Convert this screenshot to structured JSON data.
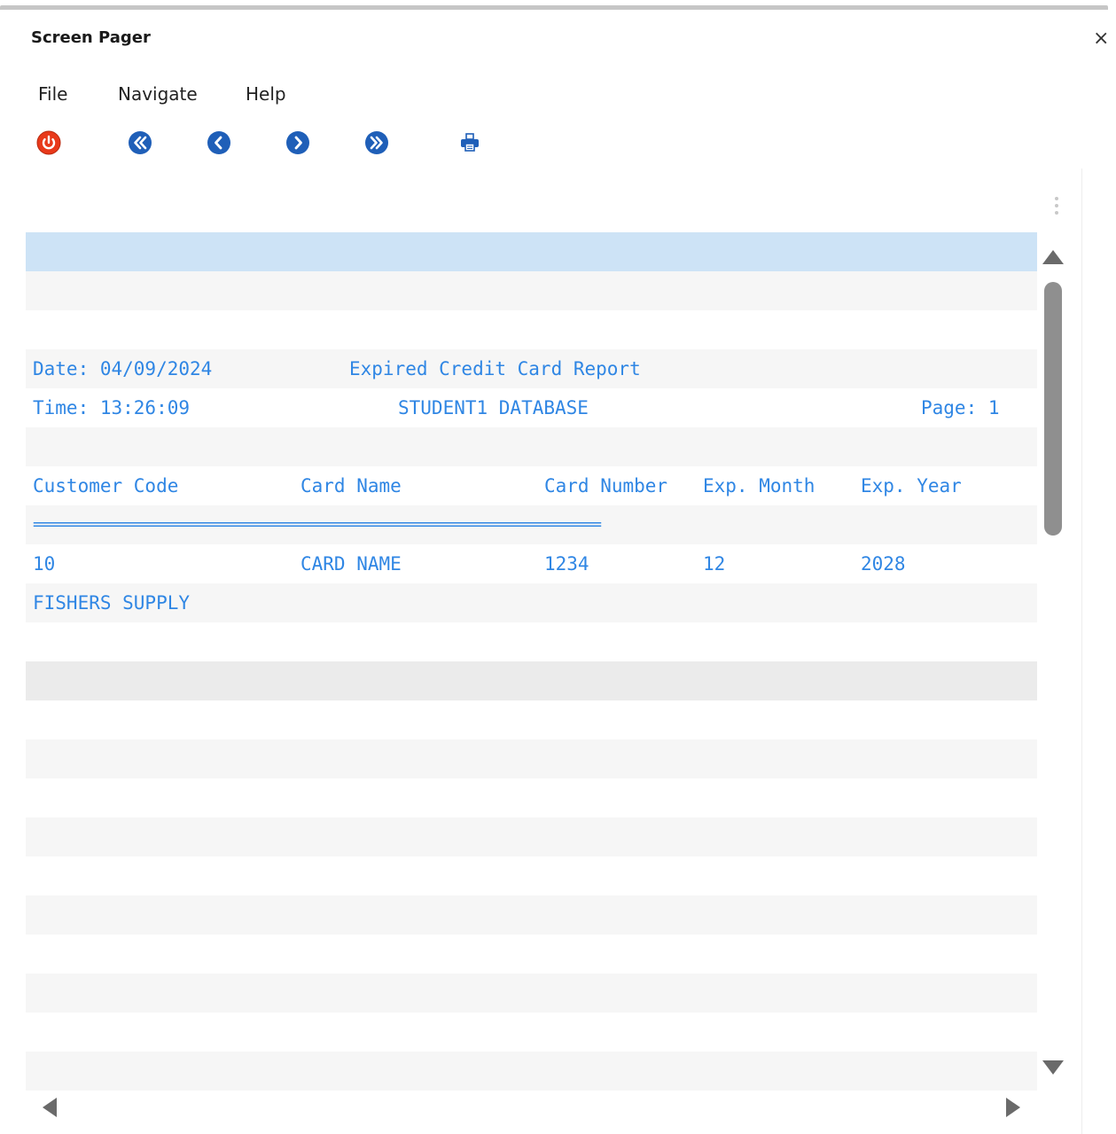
{
  "window": {
    "title": "Screen Pager",
    "close_glyph": "×"
  },
  "menu": {
    "items": [
      {
        "label": "File"
      },
      {
        "label": "Navigate"
      },
      {
        "label": "Help"
      }
    ]
  },
  "toolbar": {
    "buttons": [
      {
        "icon": "power-icon",
        "color": "#e8391a"
      },
      {
        "icon": "first-page-icon",
        "color": "#1f5fb8"
      },
      {
        "icon": "previous-page-icon",
        "color": "#1f5fb8"
      },
      {
        "icon": "next-page-icon",
        "color": "#1f5fb8"
      },
      {
        "icon": "last-page-icon",
        "color": "#1f5fb8"
      },
      {
        "icon": "printer-icon",
        "color": "#1f5fb8"
      }
    ]
  },
  "report": {
    "text_color": "#2f86e4",
    "date": "Date: 04/09/2024",
    "title": "Expired Credit Card Report",
    "time": "Time: 13:26:09",
    "database": "STUDENT1 DATABASE",
    "page": "Page: 1",
    "headers": {
      "customer_code": "Customer Code",
      "card_name": "Card Name",
      "card_number": "Card Number",
      "exp_month": "Exp. Month",
      "exp_year": "Exp. Year"
    },
    "separator": "================================================================================",
    "rows": [
      {
        "customer_code": "10",
        "card_name": "CARD NAME",
        "card_number": "1234",
        "exp_month": "12",
        "exp_year": "2028",
        "customer_name": "FISHERS SUPPLY"
      }
    ]
  },
  "colors": {
    "selected_row": "#cde3f6",
    "alt_row": "#f6f6f6",
    "scrollbar_thumb": "#8f8f8f"
  }
}
